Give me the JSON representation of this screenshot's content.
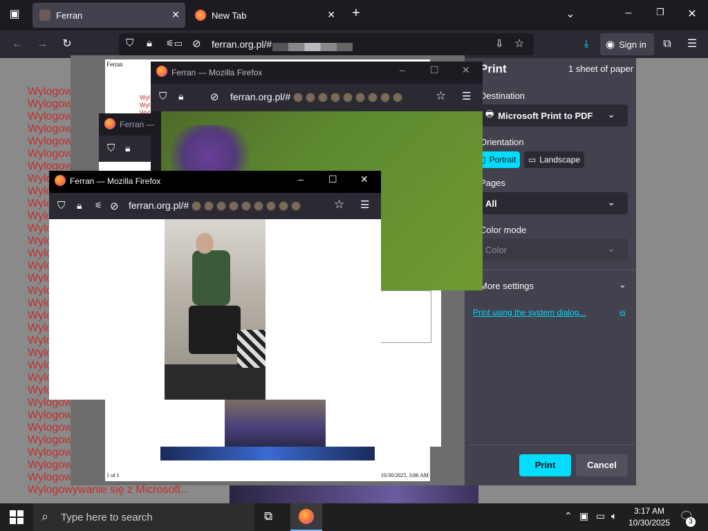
{
  "browser": {
    "tabs": [
      {
        "label": "Ferran",
        "active": true
      },
      {
        "label": "New Tab",
        "active": false
      }
    ],
    "url": "ferran.org.pl/#",
    "sign_in": "Sign in"
  },
  "background_page": {
    "list_item": "Wylogow",
    "spotify_line": "Wylogowywanie się z Spotify...",
    "microsoft_line": "Wylogowywanie się z Microsoft..."
  },
  "preview": {
    "page_title": "Ferran",
    "footer_left": "1 of 1",
    "footer_right": "10/30/2025, 3:06 AM",
    "small_red": [
      "Wyl",
      "Wyl",
      "Wyl"
    ]
  },
  "print_panel": {
    "title": "Print",
    "sheets": "1 sheet of paper",
    "destination_label": "Destination",
    "destination_value": "Microsoft Print to PDF",
    "orientation_label": "Orientation",
    "portrait": "Portrait",
    "landscape": "Landscape",
    "pages_label": "Pages",
    "pages_value": "All",
    "color_label": "Color mode",
    "color_value": "Color",
    "more_settings": "More settings",
    "system_dialog": "Print using the system dialog...",
    "print_btn": "Print",
    "cancel_btn": "Cancel"
  },
  "windows": [
    {
      "title": "Ferran — Mozilla Firefox",
      "url": "ferran.org.pl/#"
    },
    {
      "title": "Ferran — ",
      "url": ""
    },
    {
      "title": "Ferran — Mozilla Firefox",
      "url": "ferran.org.pl/#"
    }
  ],
  "taskbar": {
    "search_placeholder": "Type here to search",
    "time": "3:17 AM",
    "date": "10/30/2025",
    "notif_count": "3"
  },
  "colors": {
    "accent": "#00ddff",
    "red_text": "#c42b2b",
    "chrome_dark": "#1c1b22",
    "chrome_mid": "#2b2a33"
  }
}
